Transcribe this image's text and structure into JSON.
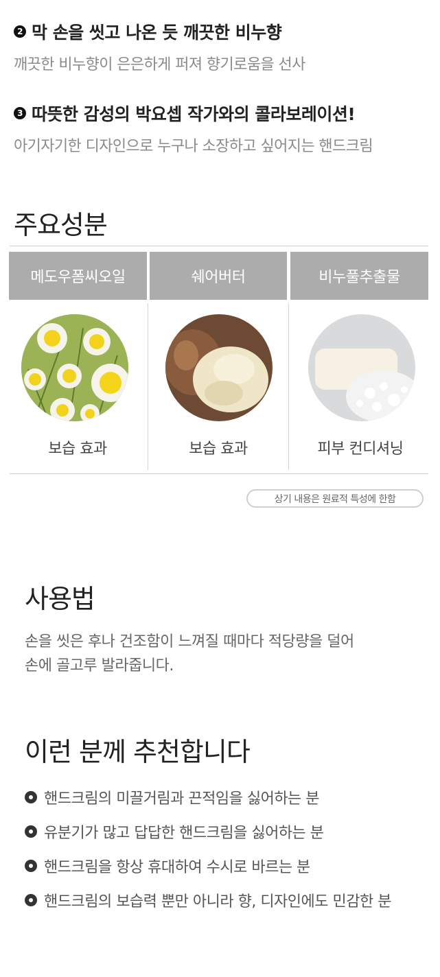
{
  "features": [
    {
      "number": "2",
      "title": "막 손을 씻고 나온 듯 깨끗한 비누향",
      "desc": "깨끗한 비누향이 은은하게 퍼져 향기로움을 선사"
    },
    {
      "number": "3",
      "title": "따뜻한 감성의 박요셉 작가와의 콜라보레이션!",
      "desc": "아기자기한 디자인으로 누구나 소장하고 싶어지는 핸드크림"
    }
  ],
  "ingredients": {
    "title": "주요성분",
    "items": [
      {
        "name": "메도우폼씨오일",
        "effect": "보습 효과",
        "image": "meadowfoam-flower"
      },
      {
        "name": "쉐어버터",
        "effect": "보습 효과",
        "image": "shea-butter"
      },
      {
        "name": "비누풀추출물",
        "effect": "피부 컨디셔닝",
        "image": "soapwort-foam"
      }
    ],
    "note": "상기 내용은 원료적 특성에 한함"
  },
  "usage": {
    "title": "사용법",
    "lines": [
      "손을 씻은 후나 건조함이 느껴질 때마다 적당량을 덜어",
      "손에 골고루 발라줍니다."
    ]
  },
  "recommend": {
    "title": "이런 분께 추천합니다",
    "items": [
      "핸드크림의 미끌거림과 끈적임을 싫어하는 분",
      "유분기가 많고 답답한 핸드크림을 싫어하는 분",
      "핸드크림을 항상 휴대하여 수시로 바르는 분",
      "핸드크림의 보습력 뿐만 아니라 향, 디자인에도 민감한 분"
    ]
  },
  "colors": {
    "header_bg": "#acacac",
    "text_main": "#222222",
    "text_sub": "#8a8a8a"
  }
}
